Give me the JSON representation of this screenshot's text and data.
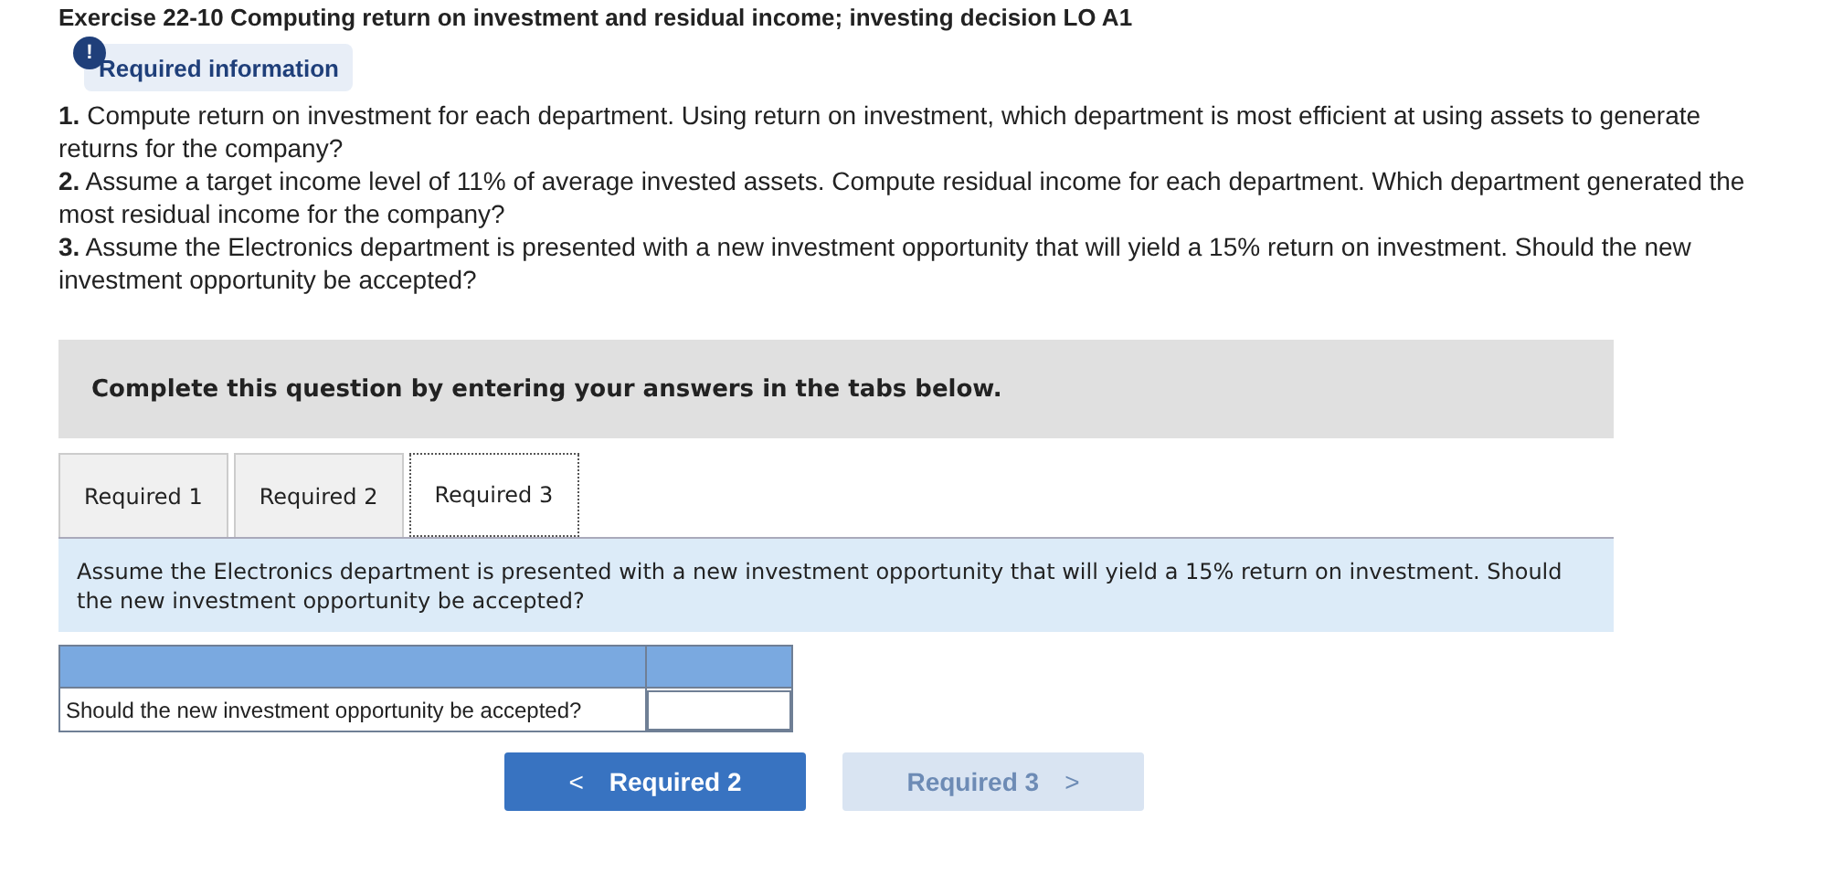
{
  "exercise_title": "Exercise 22-10 Computing return on investment and residual income; investing decision LO A1",
  "notice": {
    "label": "Required information",
    "icon": "!"
  },
  "requirements": [
    "**1.** Compute return on investment for each department. Using return on investment, which department is most efficient at using assets to generate returns for the company?",
    "**2.** Assume a target income level of 11% of average invested assets. Compute residual income for each department. Which department generated the most residual income for the company?",
    "**3.** Assume the Electronics department is presented with a new investment opportunity that will yield a 15% return on investment. Should the new investment opportunity be accepted?"
  ],
  "instruction": "Complete this question by entering your answers in the tabs below.",
  "tabs": [
    {
      "label": "Required 1",
      "selected": false
    },
    {
      "label": "Required 2",
      "selected": false
    },
    {
      "label": "Required 3",
      "selected": true
    }
  ],
  "prompt": "Assume the Electronics department is presented with a new investment opportunity that will yield a 15% return on investment. Should the new investment opportunity be accepted?",
  "answer_table": {
    "rows": [
      {
        "label": "Should the new investment opportunity be accepted?"
      }
    ]
  },
  "nav_buttons": [
    {
      "kind": "prev",
      "label": "Required 2",
      "icon": "<",
      "disabled": false
    },
    {
      "kind": "next",
      "label": "Required 3",
      "icon": ">",
      "disabled": true
    }
  ]
}
